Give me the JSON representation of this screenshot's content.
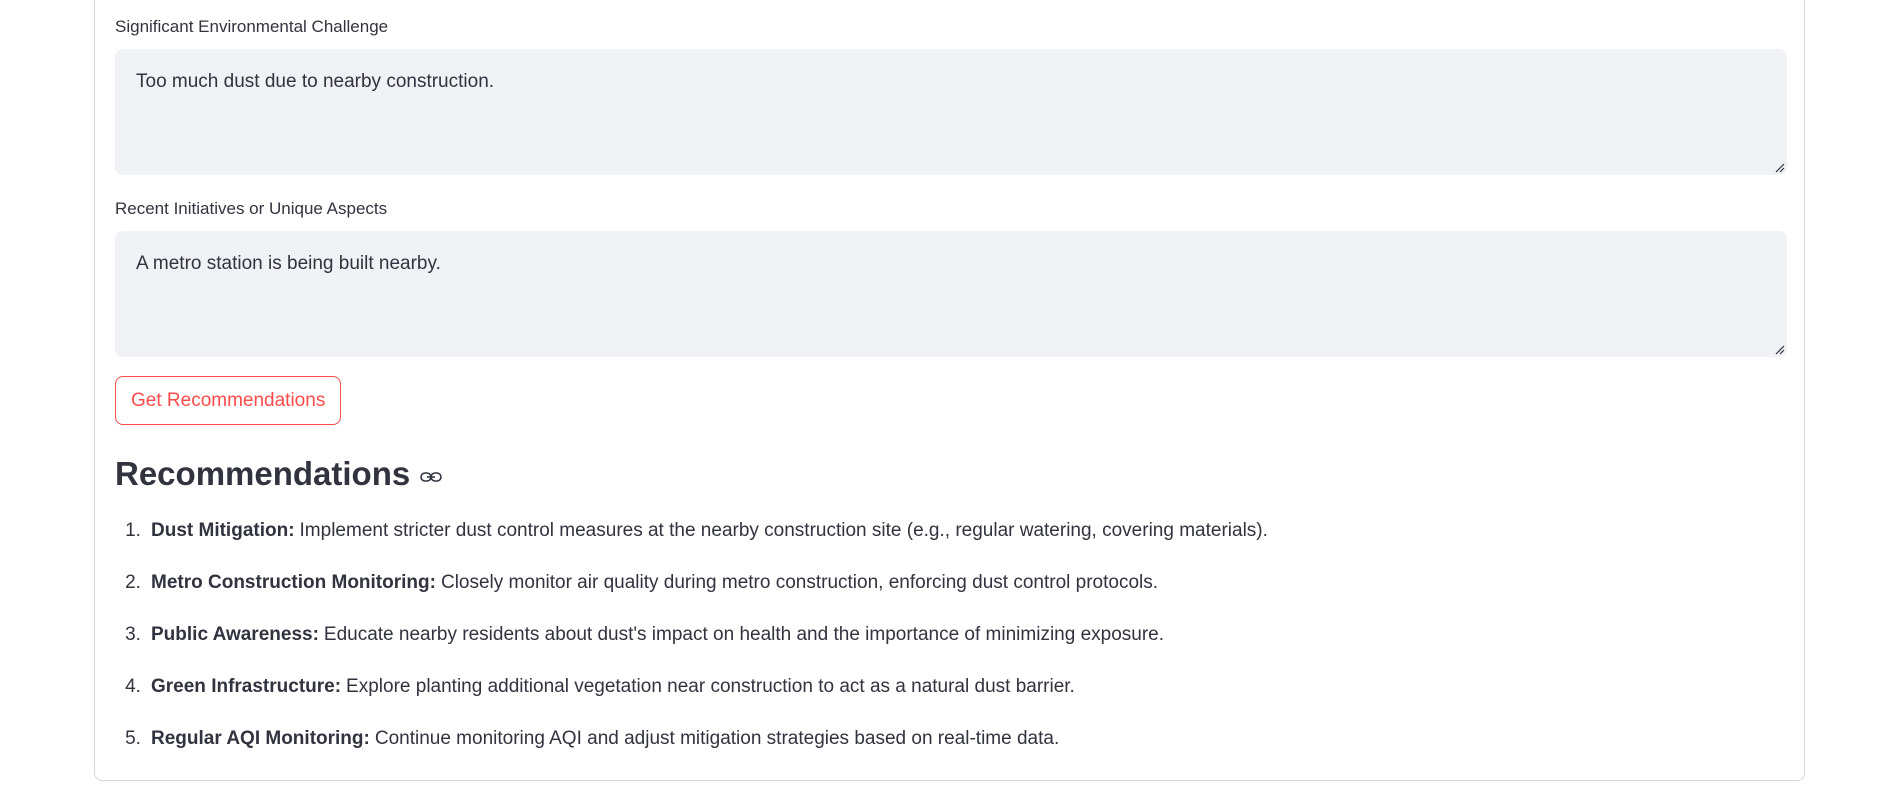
{
  "fields": [
    {
      "label": "Significant Environmental Challenge",
      "value": "Too much dust due to nearby construction."
    },
    {
      "label": "Recent Initiatives or Unique Aspects",
      "value": "A metro station is being built nearby."
    }
  ],
  "button": {
    "label": "Get Recommendations"
  },
  "recommendations": {
    "heading": "Recommendations",
    "items": [
      {
        "number": "1.",
        "title": "Dust Mitigation:",
        "text": "Implement stricter dust control measures at the nearby construction site (e.g., regular watering, covering materials)."
      },
      {
        "number": "2.",
        "title": "Metro Construction Monitoring:",
        "text": "Closely monitor air quality during metro construction, enforcing dust control protocols."
      },
      {
        "number": "3.",
        "title": "Public Awareness:",
        "text": "Educate nearby residents about dust's impact on health and the importance of minimizing exposure."
      },
      {
        "number": "4.",
        "title": "Green Infrastructure:",
        "text": "Explore planting additional vegetation near construction to act as a natural dust barrier."
      },
      {
        "number": "5.",
        "title": "Regular AQI Monitoring:",
        "text": "Continue monitoring AQI and adjust mitigation strategies based on real-time data."
      }
    ]
  },
  "colors": {
    "accent": "#ff4b4b",
    "text": "#31333f",
    "input_bg": "#f0f2f6",
    "border": "#d6d6d9"
  },
  "icons": {
    "heading_anchor": "link-icon",
    "textarea_resize": "resize-grip-icon"
  }
}
